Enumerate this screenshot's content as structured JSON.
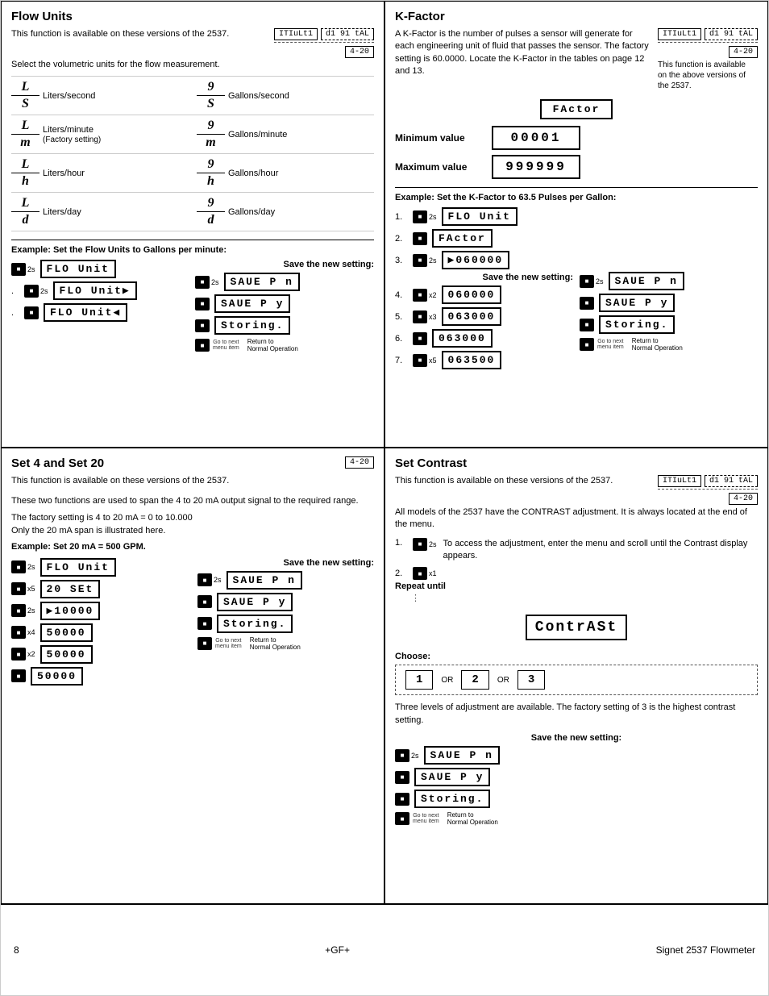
{
  "page": {
    "number": "8",
    "brand": "+GF+",
    "product": "Signet 2537 Flowmeter"
  },
  "flowUnits": {
    "title": "Flow Units",
    "desc": "This function is available on these versions of the 2537.",
    "version1": "ITIuLt1",
    "version2": "d1 91 tAL",
    "version3": "4-20",
    "selectText": "Select the volumetric units for the flow measurement.",
    "units": [
      {
        "symbol_top": "L",
        "symbol_bot": "S",
        "label": "Liters/second",
        "right_top": "9",
        "right_bot": "S",
        "right_label": "Gallons/second"
      },
      {
        "symbol_top": "L",
        "symbol_bot": "m",
        "label": "Liters/minute\n(Factory setting)",
        "right_top": "9",
        "right_bot": "m",
        "right_label": "Gallons/minute"
      },
      {
        "symbol_top": "L",
        "symbol_bot": "h",
        "label": "Liters/hour",
        "right_top": "9",
        "right_bot": "h",
        "right_label": "Gallons/hour"
      },
      {
        "symbol_top": "L",
        "symbol_bot": "d",
        "label": "Liters/day",
        "right_top": "9",
        "right_bot": "d",
        "right_label": "Gallons/day"
      }
    ],
    "exampleTitle": "Example: Set the Flow Units to Gallons per minute:",
    "saveNewSetting": "Save the new setting:",
    "steps_left": [
      {
        "num": "",
        "display": "FLO Unit",
        "btn": "■",
        "sub": "2s"
      },
      {
        "num": ".",
        "display": "FLO Unit▶",
        "btn": "■",
        "sub": "2s"
      },
      {
        "num": ".",
        "display": "FLO Unit◀",
        "btn": "■",
        "sub": ""
      }
    ],
    "steps_right": [
      {
        "display": "SAUE P n",
        "btn": "■",
        "sub": "2s"
      },
      {
        "display": "SAUE P y",
        "btn": "■",
        "sub": ""
      },
      {
        "display": "Storing.",
        "btn": "■",
        "sub": ""
      },
      {
        "display": "Go to next menu item",
        "btn": "■",
        "sub": "",
        "note": "Return to Normal Operation"
      }
    ]
  },
  "kfactor": {
    "title": "K-Factor",
    "desc": "A K-Factor is the number of pulses a sensor will generate for each engineering unit of fluid that passes the sensor. The factory setting is 60.0000. Locate the K-Factor in the tables on page 12 and 13.",
    "version1": "ITIuLt1",
    "version2": "d1 91 tAL",
    "version3": "4-20",
    "availableText": "This function is available on the above versions of the 2537.",
    "displayLabel": "FActor",
    "minLabel": "Minimum value",
    "minValue": "00001",
    "maxLabel": "Maximum value",
    "maxValue": "999999",
    "exampleTitle": "Example: Set the K-Factor to 63.5 Pulses per Gallon:",
    "saveNewSetting": "Save the new setting:",
    "steps": [
      {
        "num": "1.",
        "display": "FLO Unit",
        "btn": "■",
        "sub": "2s"
      },
      {
        "num": "2.",
        "display": "FActor",
        "btn": "■",
        "sub": ""
      },
      {
        "num": "3.",
        "display": "▶060000",
        "btn": "■",
        "sub": "2s"
      },
      {
        "num": "4.",
        "display": "060000",
        "btn": "■",
        "sub": "x2",
        "save_display": "SAUE P n",
        "save_sub": "2s"
      },
      {
        "num": "5.",
        "display": "063000",
        "btn": "■",
        "sub": "x3",
        "save_display": "SAUE P y",
        "save_sub": ""
      },
      {
        "num": "6.",
        "display": "063000",
        "btn": "■",
        "sub": "",
        "save_display": "Storing.",
        "save_sub": ""
      },
      {
        "num": "7.",
        "display": "063500",
        "btn": "■",
        "sub": "x5"
      }
    ],
    "goToNext": "Go to next menu item",
    "returnNormal": "Return to Normal Operation"
  },
  "set4and20": {
    "title": "Set 4 and Set 20",
    "version": "4-20",
    "desc1": "This function is available on these versions of the 2537.",
    "desc2": "These two functions are used to span the 4 to 20 mA output signal to the required range.",
    "desc3": "The factory setting is 4 to 20 mA = 0 to 10.000",
    "desc4": "Only the 20 mA span is illustrated here.",
    "exampleTitle": "Example: Set 20 mA = 500 GPM.",
    "saveNewSetting": "Save the new setting:",
    "steps_left": [
      {
        "display": "FLO Unit",
        "btn": "■",
        "sub": "2s"
      },
      {
        "display": "20 SEt",
        "btn": "■",
        "sub": "x5"
      },
      {
        "display": "▶10000",
        "btn": "■",
        "sub": "2s"
      },
      {
        "display": "50000",
        "btn": "■",
        "sub": "x4"
      },
      {
        "display": "50000",
        "btn": "■",
        "sub": "x2"
      },
      {
        "display": "50000",
        "btn": "■",
        "sub": ""
      }
    ],
    "steps_right": [
      {
        "display": "SAUE P n",
        "btn": "■",
        "sub": "2s"
      },
      {
        "display": "SAUE P y",
        "btn": "■",
        "sub": ""
      },
      {
        "display": "Storing.",
        "btn": "■",
        "sub": ""
      },
      {
        "note1": "Go to next menu item",
        "note2": "Return to Normal Operation"
      }
    ]
  },
  "setContrast": {
    "title": "Set Contrast",
    "version1": "ITIuLt1",
    "version2": "d1 91 tAL",
    "version3": "4-20",
    "desc1": "This function is available on these versions of the 2537.",
    "desc2": "All models of the 2537 have the CONTRAST adjustment. It is always located at the end of the menu.",
    "step1_desc": "To access the adjustment, enter the menu and scroll until the Contrast display appears.",
    "step2_desc": "Repeat until",
    "contrastDisplay": "ContrASt",
    "chooseLabel": "Choose:",
    "options": [
      "1",
      "2",
      "3"
    ],
    "orLabel": "OR",
    "optionDesc": "Three levels of adjustment are available. The factory setting of 3 is the highest contrast setting.",
    "saveNewSetting": "Save the new setting:",
    "save_steps": [
      {
        "display": "SAUE P n",
        "btn": "■",
        "sub": "2s"
      },
      {
        "display": "SAUE P y",
        "btn": "■",
        "sub": ""
      },
      {
        "display": "Storing.",
        "btn": "■",
        "sub": ""
      }
    ],
    "goToNext": "Go to next menu item",
    "returnNormal": "Return to Normal Operation"
  }
}
